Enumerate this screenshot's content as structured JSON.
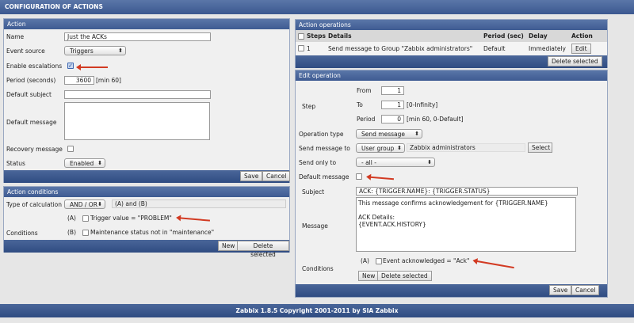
{
  "page_title": "CONFIGURATION OF ACTIONS",
  "action": {
    "header": "Action",
    "name_label": "Name",
    "name_value": "Just the ACKs",
    "event_source_label": "Event source",
    "event_source_value": "Triggers",
    "enable_escalations_label": "Enable escalations",
    "enable_escalations_checked": true,
    "period_label": "Period (seconds)",
    "period_value": "3600",
    "period_hint": "[min 60]",
    "default_subject_label": "Default subject",
    "default_subject_value": "",
    "default_message_label": "Default message",
    "default_message_value": "",
    "recovery_message_label": "Recovery message",
    "recovery_message_checked": false,
    "status_label": "Status",
    "status_value": "Enabled",
    "save": "Save",
    "cancel": "Cancel"
  },
  "conditions": {
    "header": "Action conditions",
    "calc_label": "Type of calculation",
    "calc_value": "AND / OR",
    "calc_expr": "(A) and (B)",
    "conditions_label": "Conditions",
    "items": [
      {
        "tag": "(A)",
        "text": "Trigger value = \"PROBLEM\""
      },
      {
        "tag": "(B)",
        "text": "Maintenance status not in \"maintenance\""
      }
    ],
    "new": "New",
    "delete_selected": "Delete selected"
  },
  "operations": {
    "header": "Action operations",
    "columns": [
      "Steps",
      "Details",
      "Period (sec)",
      "Delay",
      "Action"
    ],
    "rows": [
      {
        "steps": "1",
        "details": "Send message to Group \"Zabbix administrators\"",
        "period": "Default",
        "delay": "Immediately",
        "action": "Edit"
      }
    ],
    "delete_selected": "Delete selected"
  },
  "edit_operation": {
    "header": "Edit operation",
    "step_label": "Step",
    "from_label": "From",
    "from_value": "1",
    "to_label": "To",
    "to_value": "1",
    "to_hint": "[0-Infinity]",
    "period_label": "Period",
    "period_value": "0",
    "period_hint": "[min 60, 0-Default]",
    "op_type_label": "Operation type",
    "op_type_value": "Send message",
    "send_to_label": "Send message to",
    "send_to_type": "User group",
    "send_to_value": "Zabbix administrators",
    "select": "Select",
    "send_only_label": "Send only to",
    "send_only_value": "- all -",
    "default_message_label": "Default message",
    "default_message_checked": false,
    "subject_label": "Subject",
    "subject_value": "ACK: {TRIGGER.NAME}: {TRIGGER.STATUS}",
    "message_label": "Message",
    "message_value": "This message confirms acknowledgement for {TRIGGER.NAME}\n\nACK Details:\n{EVENT.ACK.HISTORY}",
    "conditions_label": "Conditions",
    "condition_tag": "(A)",
    "condition_text": "Event acknowledged = \"Ack\"",
    "new": "New",
    "delete_selected": "Delete selected",
    "save": "Save",
    "cancel": "Cancel"
  },
  "footer": "Zabbix 1.8.5 Copyright 2001-2011 by SIA Zabbix",
  "colors": {
    "header_blue": "#3e5b92",
    "arrow_red": "#d23a22"
  }
}
